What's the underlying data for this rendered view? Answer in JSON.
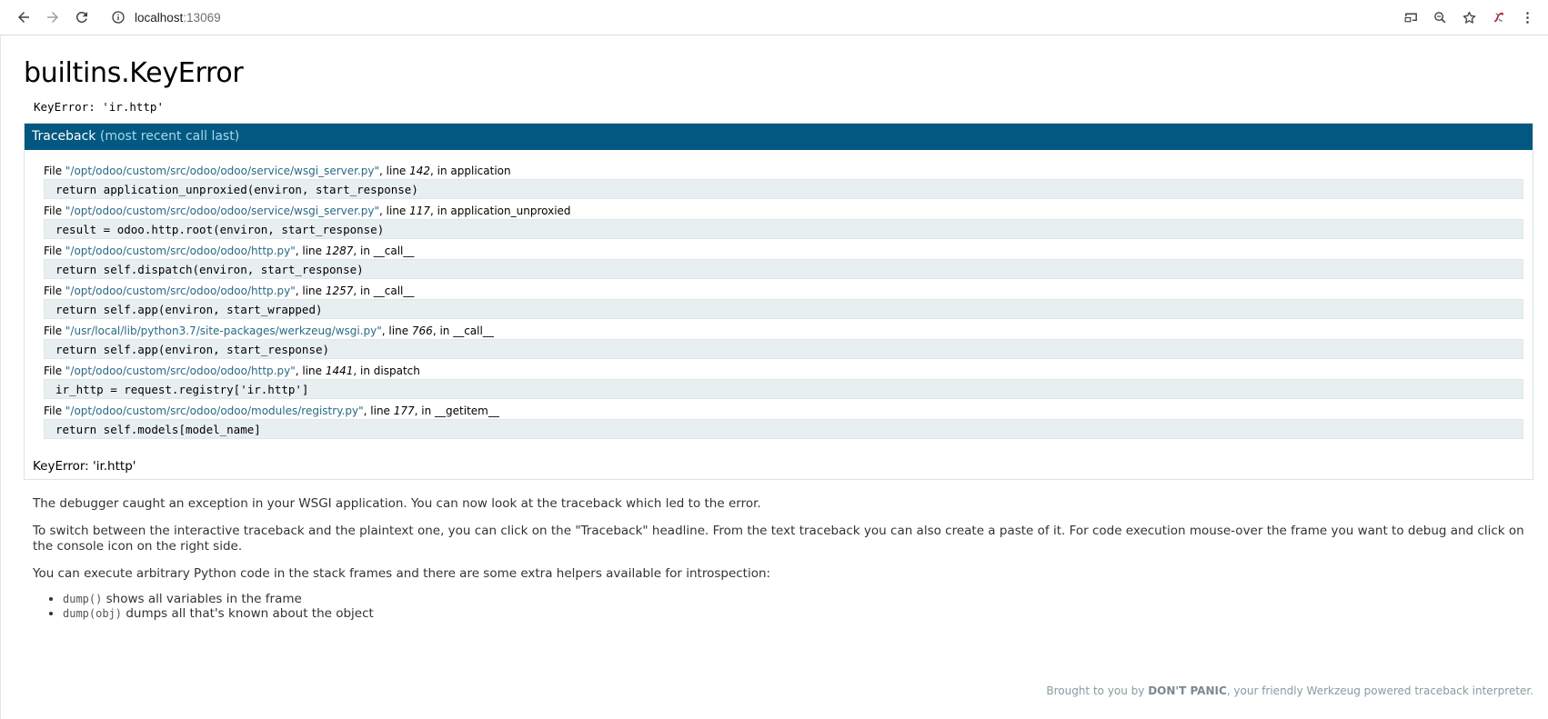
{
  "browser": {
    "url_host": "localhost",
    "url_rest": ":13069"
  },
  "page": {
    "title": "builtins.KeyError",
    "error_message": "KeyError: 'ir.http'",
    "traceback_header": "Traceback",
    "traceback_sub": "(most recent call last)",
    "frames": [
      {
        "prefix": "File ",
        "filename": "\"/opt/odoo/custom/src/odoo/odoo/service/wsgi_server.py\"",
        "line_label": ", line ",
        "lineno": "142",
        "in_label": ", in ",
        "func": "application",
        "code": "return application_unproxied(environ, start_response)"
      },
      {
        "prefix": "File ",
        "filename": "\"/opt/odoo/custom/src/odoo/odoo/service/wsgi_server.py\"",
        "line_label": ", line ",
        "lineno": "117",
        "in_label": ", in ",
        "func": "application_unproxied",
        "code": "result = odoo.http.root(environ, start_response)"
      },
      {
        "prefix": "File ",
        "filename": "\"/opt/odoo/custom/src/odoo/odoo/http.py\"",
        "line_label": ", line ",
        "lineno": "1287",
        "in_label": ", in ",
        "func": "__call__",
        "code": "return self.dispatch(environ, start_response)"
      },
      {
        "prefix": "File ",
        "filename": "\"/opt/odoo/custom/src/odoo/odoo/http.py\"",
        "line_label": ", line ",
        "lineno": "1257",
        "in_label": ", in ",
        "func": "__call__",
        "code": "return self.app(environ, start_wrapped)"
      },
      {
        "prefix": "File ",
        "filename": "\"/usr/local/lib/python3.7/site-packages/werkzeug/wsgi.py\"",
        "line_label": ", line ",
        "lineno": "766",
        "in_label": ", in ",
        "func": "__call__",
        "code": "return self.app(environ, start_response)"
      },
      {
        "prefix": "File ",
        "filename": "\"/opt/odoo/custom/src/odoo/odoo/http.py\"",
        "line_label": ", line ",
        "lineno": "1441",
        "in_label": ", in ",
        "func": "dispatch",
        "code": "ir_http = request.registry['ir.http']"
      },
      {
        "prefix": "File ",
        "filename": "\"/opt/odoo/custom/src/odoo/odoo/modules/registry.py\"",
        "line_label": ", line ",
        "lineno": "177",
        "in_label": ", in ",
        "func": "__getitem__",
        "code": "return self.models[model_name]"
      }
    ],
    "final_error": "KeyError: 'ir.http'",
    "explanation": {
      "p1": "The debugger caught an exception in your WSGI application. You can now look at the traceback which led to the error.",
      "p2": "To switch between the interactive traceback and the plaintext one, you can click on the \"Traceback\" headline. From the text traceback you can also create a paste of it. For code execution mouse-over the frame you want to debug and click on the console icon on the right side.",
      "p3": "You can execute arbitrary Python code in the stack frames and there are some extra helpers available for introspection:",
      "helpers": [
        {
          "code": "dump()",
          "text": " shows all variables in the frame"
        },
        {
          "code": "dump(obj)",
          "text": " dumps all that's known about the object"
        }
      ]
    },
    "footer": {
      "prefix": "Brought to you by ",
      "brand": "DON'T PANIC",
      "suffix": ", your friendly Werkzeug powered traceback interpreter."
    }
  }
}
